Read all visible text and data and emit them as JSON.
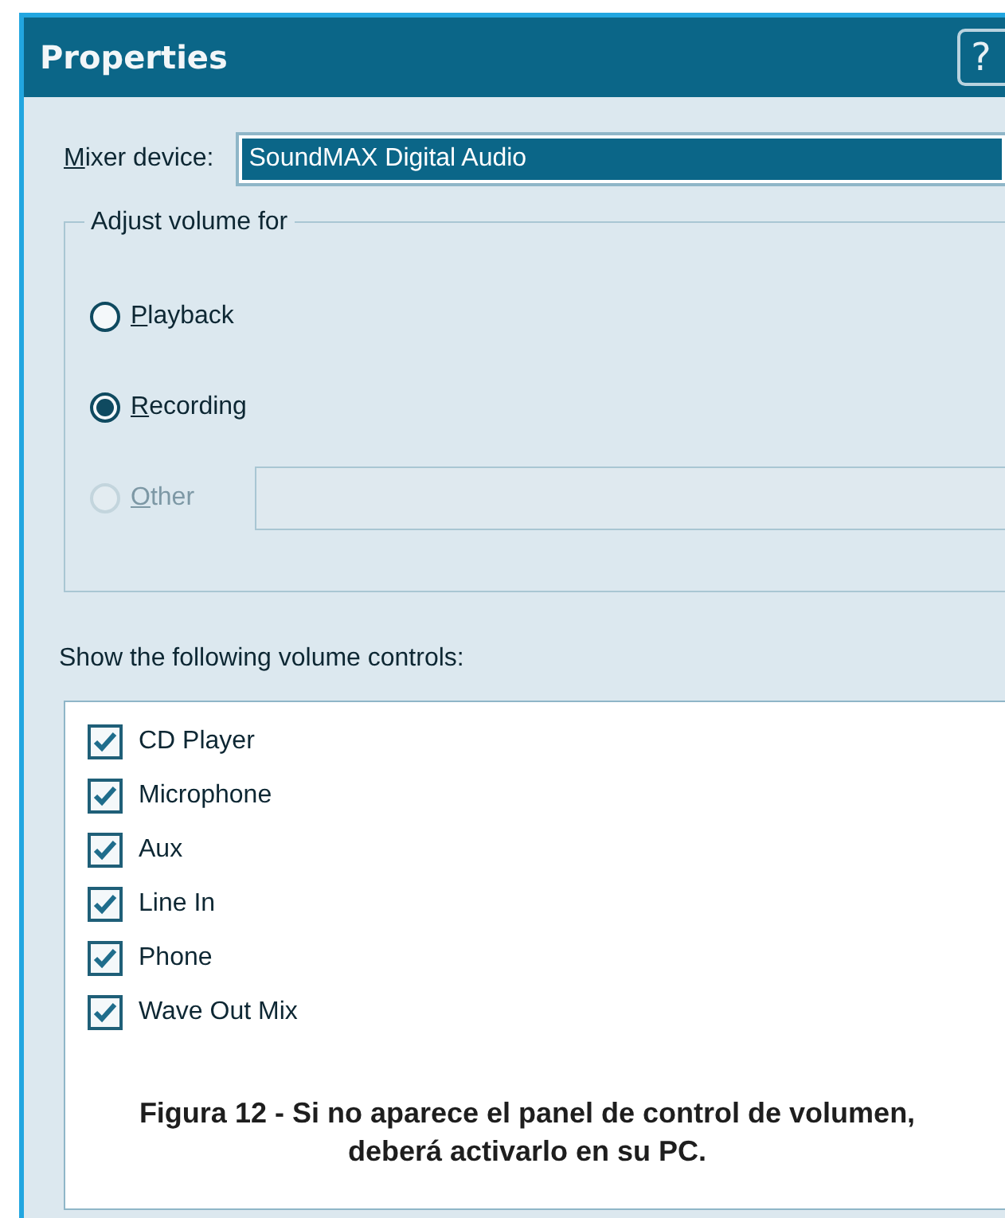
{
  "window": {
    "title": "Properties",
    "help_button": "?"
  },
  "mixer": {
    "label_parts": [
      {
        "text": "M",
        "underline": true
      },
      {
        "text": "ixer device:",
        "underline": false
      }
    ],
    "value": "SoundMAX Digital Audio",
    "selected": true
  },
  "adjust_group": {
    "title": "Adjust volume for",
    "options": [
      {
        "label_parts": [
          {
            "text": "P",
            "underline": true
          },
          {
            "text": "layback",
            "underline": false
          }
        ],
        "selected": false,
        "disabled": false
      },
      {
        "label_parts": [
          {
            "text": "R",
            "underline": true
          },
          {
            "text": "ecording",
            "underline": false
          }
        ],
        "selected": true,
        "disabled": false
      },
      {
        "label_parts": [
          {
            "text": "O",
            "underline": true
          },
          {
            "text": "ther",
            "underline": false
          }
        ],
        "selected": false,
        "disabled": true,
        "has_combo": true
      }
    ]
  },
  "controls_label": "Show the following volume controls:",
  "controls": [
    {
      "label": "CD Player",
      "checked": true
    },
    {
      "label": "Microphone",
      "checked": true
    },
    {
      "label": "Aux",
      "checked": true
    },
    {
      "label": "Line In",
      "checked": true
    },
    {
      "label": "Phone",
      "checked": true
    },
    {
      "label": "Wave Out Mix",
      "checked": true
    }
  ],
  "caption": "Figura 12 - Si no aparece el panel de control de volumen, deberá activarlo en su PC."
}
